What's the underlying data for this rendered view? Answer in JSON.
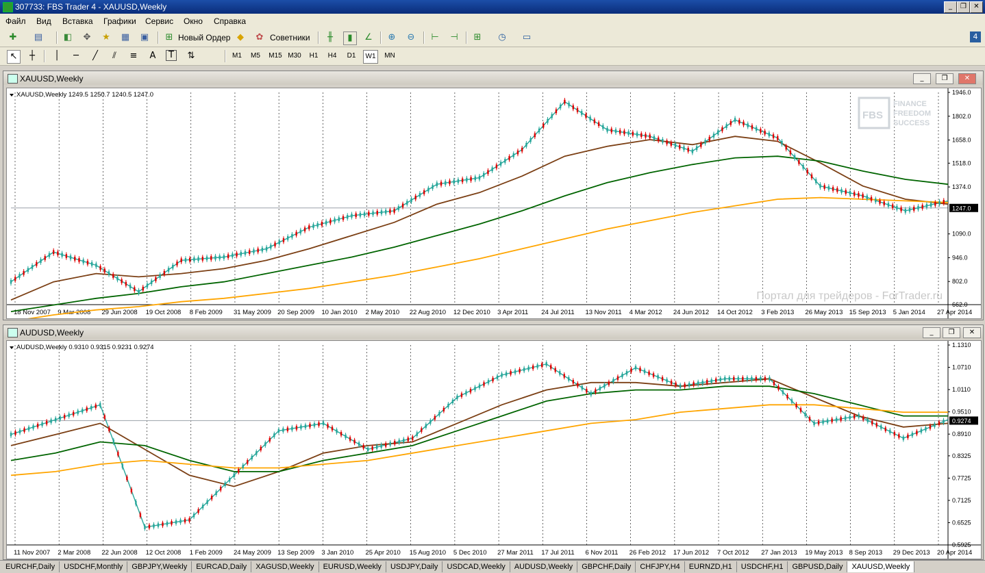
{
  "window": {
    "title": "307733: FBS Trader 4 - XAUUSD,Weekly",
    "buttons": [
      "_",
      "❐",
      "✕"
    ]
  },
  "menu": [
    "Файл",
    "Вид",
    "Вставка",
    "Графики",
    "Сервис",
    "Окно",
    "Справка"
  ],
  "toolbar": {
    "new_order": "Новый Ордер",
    "advisors": "Советники",
    "corner_badge": "4"
  },
  "drawing_tools": {
    "text": "A",
    "text_label": "T"
  },
  "timeframes": [
    "M1",
    "M5",
    "M15",
    "M30",
    "H1",
    "H4",
    "D1",
    "W1",
    "MN"
  ],
  "active_timeframe": "W1",
  "charts": [
    {
      "window_title": "XAUUSD,Weekly",
      "info_line": "XAUUSD,Weekly  1249.5 1250.7 1240.5 1247.0",
      "y_labels": [
        "1946.0",
        "1802.0",
        "1658.0",
        "1518.0",
        "1374.0",
        "1247.0",
        "1090.0",
        "946.0",
        "802.0",
        "662.0"
      ],
      "current_price": "1247.0",
      "x_labels": [
        "18 Nov 2007",
        "9 Mar 2008",
        "29 Jun 2008",
        "19 Oct 2008",
        "8 Feb 2009",
        "31 May 2009",
        "20 Sep 2009",
        "10 Jan 2010",
        "2 May 2010",
        "22 Aug 2010",
        "12 Dec 2010",
        "3 Apr 2011",
        "24 Jul 2011",
        "13 Nov 2011",
        "4 Mar 2012",
        "24 Jun 2012",
        "14 Oct 2012",
        "3 Feb 2013",
        "26 May 2013",
        "15 Sep 2013",
        "5 Jan 2014",
        "27 Apr 2014"
      ],
      "watermark": "Портал для трейдеров - ForTrader.ru",
      "logo": {
        "fbs": "FBS",
        "line1": "FINANCE",
        "line2": "FREEDOM",
        "line3": "SUCCESS"
      }
    },
    {
      "window_title": "AUDUSD,Weekly",
      "info_line": "AUDUSD,Weekly  0.9310 0.9315 0.9231 0.9274",
      "y_labels": [
        "1.1310",
        "1.0710",
        "1.0110",
        "0.9510",
        "0.9274",
        "0.8910",
        "0.8325",
        "0.7725",
        "0.7125",
        "0.6525",
        "0.5925"
      ],
      "current_price": "0.9274",
      "x_labels": [
        "11 Nov 2007",
        "2 Mar 2008",
        "22 Jun 2008",
        "12 Oct 2008",
        "1 Feb 2009",
        "24 May 2009",
        "13 Sep 2009",
        "3 Jan 2010",
        "25 Apr 2010",
        "15 Aug 2010",
        "5 Dec 2010",
        "27 Mar 2011",
        "17 Jul 2011",
        "6 Nov 2011",
        "26 Feb 2012",
        "17 Jun 2012",
        "7 Oct 2012",
        "27 Jan 2013",
        "19 May 2013",
        "8 Sep 2013",
        "29 Dec 2013",
        "20 Apr 2014"
      ]
    }
  ],
  "chart_data": [
    {
      "type": "line",
      "title": "XAUUSD,Weekly",
      "x": [
        "2007-11",
        "2008-03",
        "2008-06",
        "2008-10",
        "2009-02",
        "2009-05",
        "2009-09",
        "2010-01",
        "2010-05",
        "2010-08",
        "2010-12",
        "2011-04",
        "2011-07",
        "2011-09",
        "2011-11",
        "2012-03",
        "2012-06",
        "2012-10",
        "2013-02",
        "2013-05",
        "2013-09",
        "2014-01",
        "2014-04"
      ],
      "series": [
        {
          "values": [
            800,
            980,
            900,
            740,
            930,
            950,
            1000,
            1130,
            1200,
            1230,
            1390,
            1430,
            1600,
            1890,
            1720,
            1680,
            1590,
            1780,
            1670,
            1380,
            1320,
            1230,
            1290
          ],
          "color": "#26a69a"
        },
        {
          "values": [
            690,
            800,
            850,
            830,
            850,
            880,
            930,
            1000,
            1080,
            1160,
            1270,
            1340,
            1440,
            1560,
            1620,
            1660,
            1630,
            1680,
            1650,
            1520,
            1380,
            1300,
            1270
          ],
          "color": "#7b3f14"
        },
        {
          "values": [
            620,
            660,
            700,
            730,
            770,
            800,
            850,
            900,
            950,
            1010,
            1080,
            1150,
            1230,
            1320,
            1400,
            1460,
            1510,
            1550,
            1560,
            1530,
            1470,
            1420,
            1390
          ],
          "color": "#006400"
        },
        {
          "values": [
            560,
            600,
            630,
            650,
            680,
            700,
            730,
            760,
            800,
            840,
            890,
            940,
            1000,
            1060,
            1120,
            1170,
            1220,
            1260,
            1300,
            1310,
            1300,
            1290,
            1280
          ],
          "color": "#ffa500"
        }
      ],
      "ylim": [
        662,
        1946
      ]
    },
    {
      "type": "line",
      "title": "AUDUSD,Weekly",
      "x": [
        "2007-11",
        "2008-03",
        "2008-06",
        "2008-10",
        "2009-02",
        "2009-05",
        "2009-09",
        "2010-01",
        "2010-04",
        "2010-08",
        "2010-12",
        "2011-03",
        "2011-07",
        "2011-11",
        "2012-02",
        "2012-06",
        "2012-10",
        "2013-01",
        "2013-05",
        "2013-09",
        "2013-12",
        "2014-04"
      ],
      "series": [
        {
          "values": [
            0.89,
            0.93,
            0.97,
            0.64,
            0.66,
            0.78,
            0.9,
            0.92,
            0.85,
            0.88,
            0.99,
            1.05,
            1.08,
            1.0,
            1.07,
            1.02,
            1.04,
            1.04,
            0.92,
            0.94,
            0.88,
            0.93
          ],
          "color": "#26a69a"
        },
        {
          "values": [
            0.86,
            0.89,
            0.92,
            0.85,
            0.78,
            0.75,
            0.79,
            0.84,
            0.86,
            0.87,
            0.92,
            0.97,
            1.01,
            1.03,
            1.03,
            1.02,
            1.03,
            1.04,
            0.99,
            0.94,
            0.91,
            0.92
          ],
          "color": "#7b3f14"
        },
        {
          "values": [
            0.82,
            0.84,
            0.87,
            0.86,
            0.82,
            0.79,
            0.79,
            0.82,
            0.84,
            0.86,
            0.9,
            0.94,
            0.98,
            1.0,
            1.01,
            1.01,
            1.02,
            1.02,
            1.0,
            0.97,
            0.94,
            0.94
          ],
          "color": "#006400"
        },
        {
          "values": [
            0.78,
            0.79,
            0.81,
            0.82,
            0.81,
            0.8,
            0.8,
            0.81,
            0.82,
            0.84,
            0.86,
            0.88,
            0.9,
            0.92,
            0.93,
            0.95,
            0.96,
            0.97,
            0.97,
            0.96,
            0.95,
            0.95
          ],
          "color": "#ffa500"
        }
      ],
      "ylim": [
        0.5925,
        1.131
      ]
    }
  ],
  "tabs": [
    "EURCHF,Daily",
    "USDCHF,Monthly",
    "GBPJPY,Weekly",
    "EURCAD,Daily",
    "XAGUSD,Weekly",
    "EURUSD,Weekly",
    "USDJPY,Daily",
    "USDCAD,Weekly",
    "AUDUSD,Weekly",
    "GBPCHF,Daily",
    "CHFJPY,H4",
    "EURNZD,H1",
    "USDCHF,H1",
    "GBPUSD,Daily",
    "XAUUSD,Weekly"
  ],
  "active_tab": "XAUUSD,Weekly"
}
